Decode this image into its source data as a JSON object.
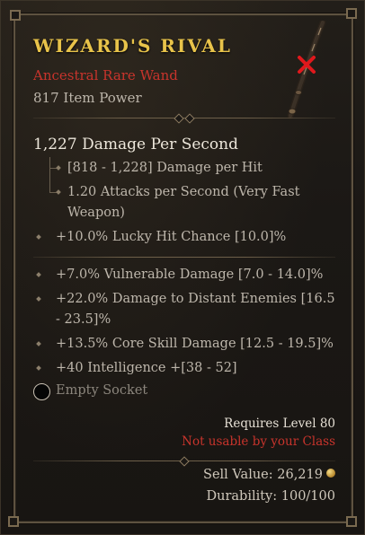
{
  "item": {
    "name": "WIZARD'S RIVAL",
    "type": "Ancestral Rare Wand",
    "item_power": "817 Item Power",
    "dps": "1,227 Damage Per Second",
    "damage_per_hit": "[818 - 1,228] Damage per Hit",
    "attacks_line1": "1.20 Attacks per Second (Very Fast",
    "attacks_line2": "Weapon)",
    "implicit": "+10.0% Lucky Hit Chance [10.0]%",
    "affixes": [
      {
        "line1": "+7.0% Vulnerable Damage [7.0 - 14.0]%"
      },
      {
        "line1": "+22.0% Damage to Distant Enemies [16.5",
        "line2": "- 23.5]%"
      },
      {
        "line1": "+13.5% Core Skill Damage [12.5 - 19.5]%"
      },
      {
        "line1": "+40 Intelligence +[38 - 52]"
      }
    ],
    "socket": "Empty Socket",
    "requires": "Requires Level 80",
    "not_usable": "Not usable by your Class",
    "sell_value": "Sell Value: 26,219",
    "durability": "Durability: 100/100"
  },
  "colors": {
    "title": "#e8c34a",
    "rare_red": "#c8342c",
    "text": "#bdb6ab",
    "accent_x": "#e0181c"
  },
  "icons": [
    "wand-icon",
    "not-usable-x-icon",
    "socket-icon",
    "gold-coin-icon"
  ]
}
